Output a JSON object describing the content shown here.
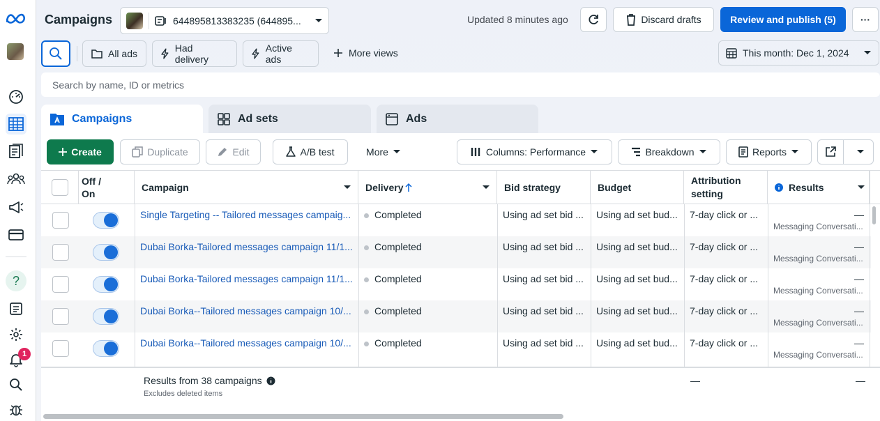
{
  "header": {
    "title": "Campaigns",
    "account_label": "644895813383235 (644895...",
    "updated_text": "Updated 8 minutes ago",
    "discard_label": "Discard drafts",
    "publish_label": "Review and publish (5)",
    "more_label": "···"
  },
  "views": {
    "all_ads": "All ads",
    "had_delivery": "Had delivery",
    "active_ads": "Active ads",
    "more_views": "More views",
    "date_range": "This month: Dec 1, 2024"
  },
  "search": {
    "placeholder": "Search by name, ID or metrics"
  },
  "tabs": [
    {
      "label": "Campaigns"
    },
    {
      "label": "Ad sets"
    },
    {
      "label": "Ads"
    }
  ],
  "toolbar": {
    "create": "Create",
    "duplicate": "Duplicate",
    "edit": "Edit",
    "ab_test": "A/B test",
    "more": "More",
    "columns": "Columns: Performance",
    "breakdown": "Breakdown",
    "reports": "Reports"
  },
  "columns": {
    "off_on": "Off / On",
    "campaign": "Campaign",
    "delivery": "Delivery",
    "bid_strategy": "Bid strategy",
    "budget": "Budget",
    "attribution": "Attribution setting",
    "results": "Results"
  },
  "rows": [
    {
      "name": "Single Targeting -- Tailored messages campaig...",
      "delivery": "Completed",
      "bid": "Using ad set bid ...",
      "budget": "Using ad set bud...",
      "attribution": "7-day click or ...",
      "results": "—",
      "results_sub": "Messaging Conversati..."
    },
    {
      "name": "Dubai Borka-Tailored messages campaign 11/1...",
      "delivery": "Completed",
      "bid": "Using ad set bid ...",
      "budget": "Using ad set bud...",
      "attribution": "7-day click or ...",
      "results": "—",
      "results_sub": "Messaging Conversati..."
    },
    {
      "name": "Dubai Borka-Tailored messages campaign 11/1...",
      "delivery": "Completed",
      "bid": "Using ad set bid ...",
      "budget": "Using ad set bud...",
      "attribution": "7-day click or ...",
      "results": "—",
      "results_sub": "Messaging Conversati..."
    },
    {
      "name": "Dubai Borka--Tailored messages campaign 10/...",
      "delivery": "Completed",
      "bid": "Using ad set bid ...",
      "budget": "Using ad set bud...",
      "attribution": "7-day click or ...",
      "results": "—",
      "results_sub": "Messaging Conversati..."
    },
    {
      "name": "Dubai Borka--Tailored messages campaign 10/...",
      "delivery": "Completed",
      "bid": "Using ad set bid ...",
      "budget": "Using ad set bud...",
      "attribution": "7-day click or ...",
      "results": "—",
      "results_sub": "Messaging Conversati..."
    }
  ],
  "footer": {
    "results_text": "Results from 38 campaigns",
    "excludes_text": "Excludes deleted items",
    "attribution_value": "—",
    "results_value": "—"
  },
  "notifications": {
    "count": "1"
  },
  "colors": {
    "primary": "#0a66d8",
    "create": "#0e7a4d",
    "link": "#1a5cb8",
    "badge": "#e0245e"
  }
}
